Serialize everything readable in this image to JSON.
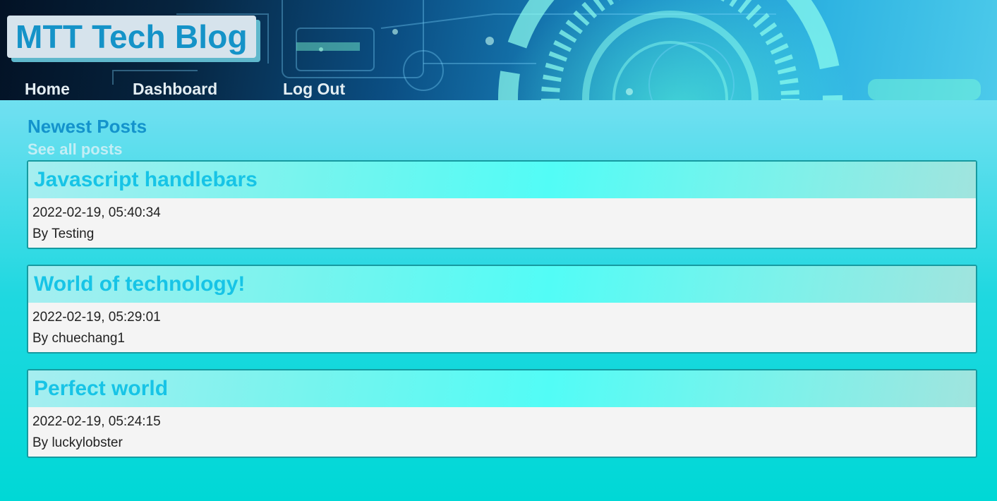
{
  "header": {
    "site_title": "MTT Tech Blog",
    "nav": [
      {
        "label": "Home"
      },
      {
        "label": "Dashboard"
      },
      {
        "label": "Log Out"
      }
    ]
  },
  "main": {
    "section_title": "Newest Posts",
    "see_all_label": "See all posts",
    "posts": [
      {
        "title": "Javascript handlebars",
        "date": "2022-02-19, 05:40:34",
        "author": "By Testing"
      },
      {
        "title": "World of technology!",
        "date": "2022-02-19, 05:29:01",
        "author": "By chuechang1"
      },
      {
        "title": "Perfect world",
        "date": "2022-02-19, 05:24:15",
        "author": "By luckylobster"
      }
    ]
  },
  "colors": {
    "accent": "#1593c8",
    "post_title": "#17c4e6",
    "post_border": "#169aa0",
    "page_bottom": "#00d8d6"
  }
}
